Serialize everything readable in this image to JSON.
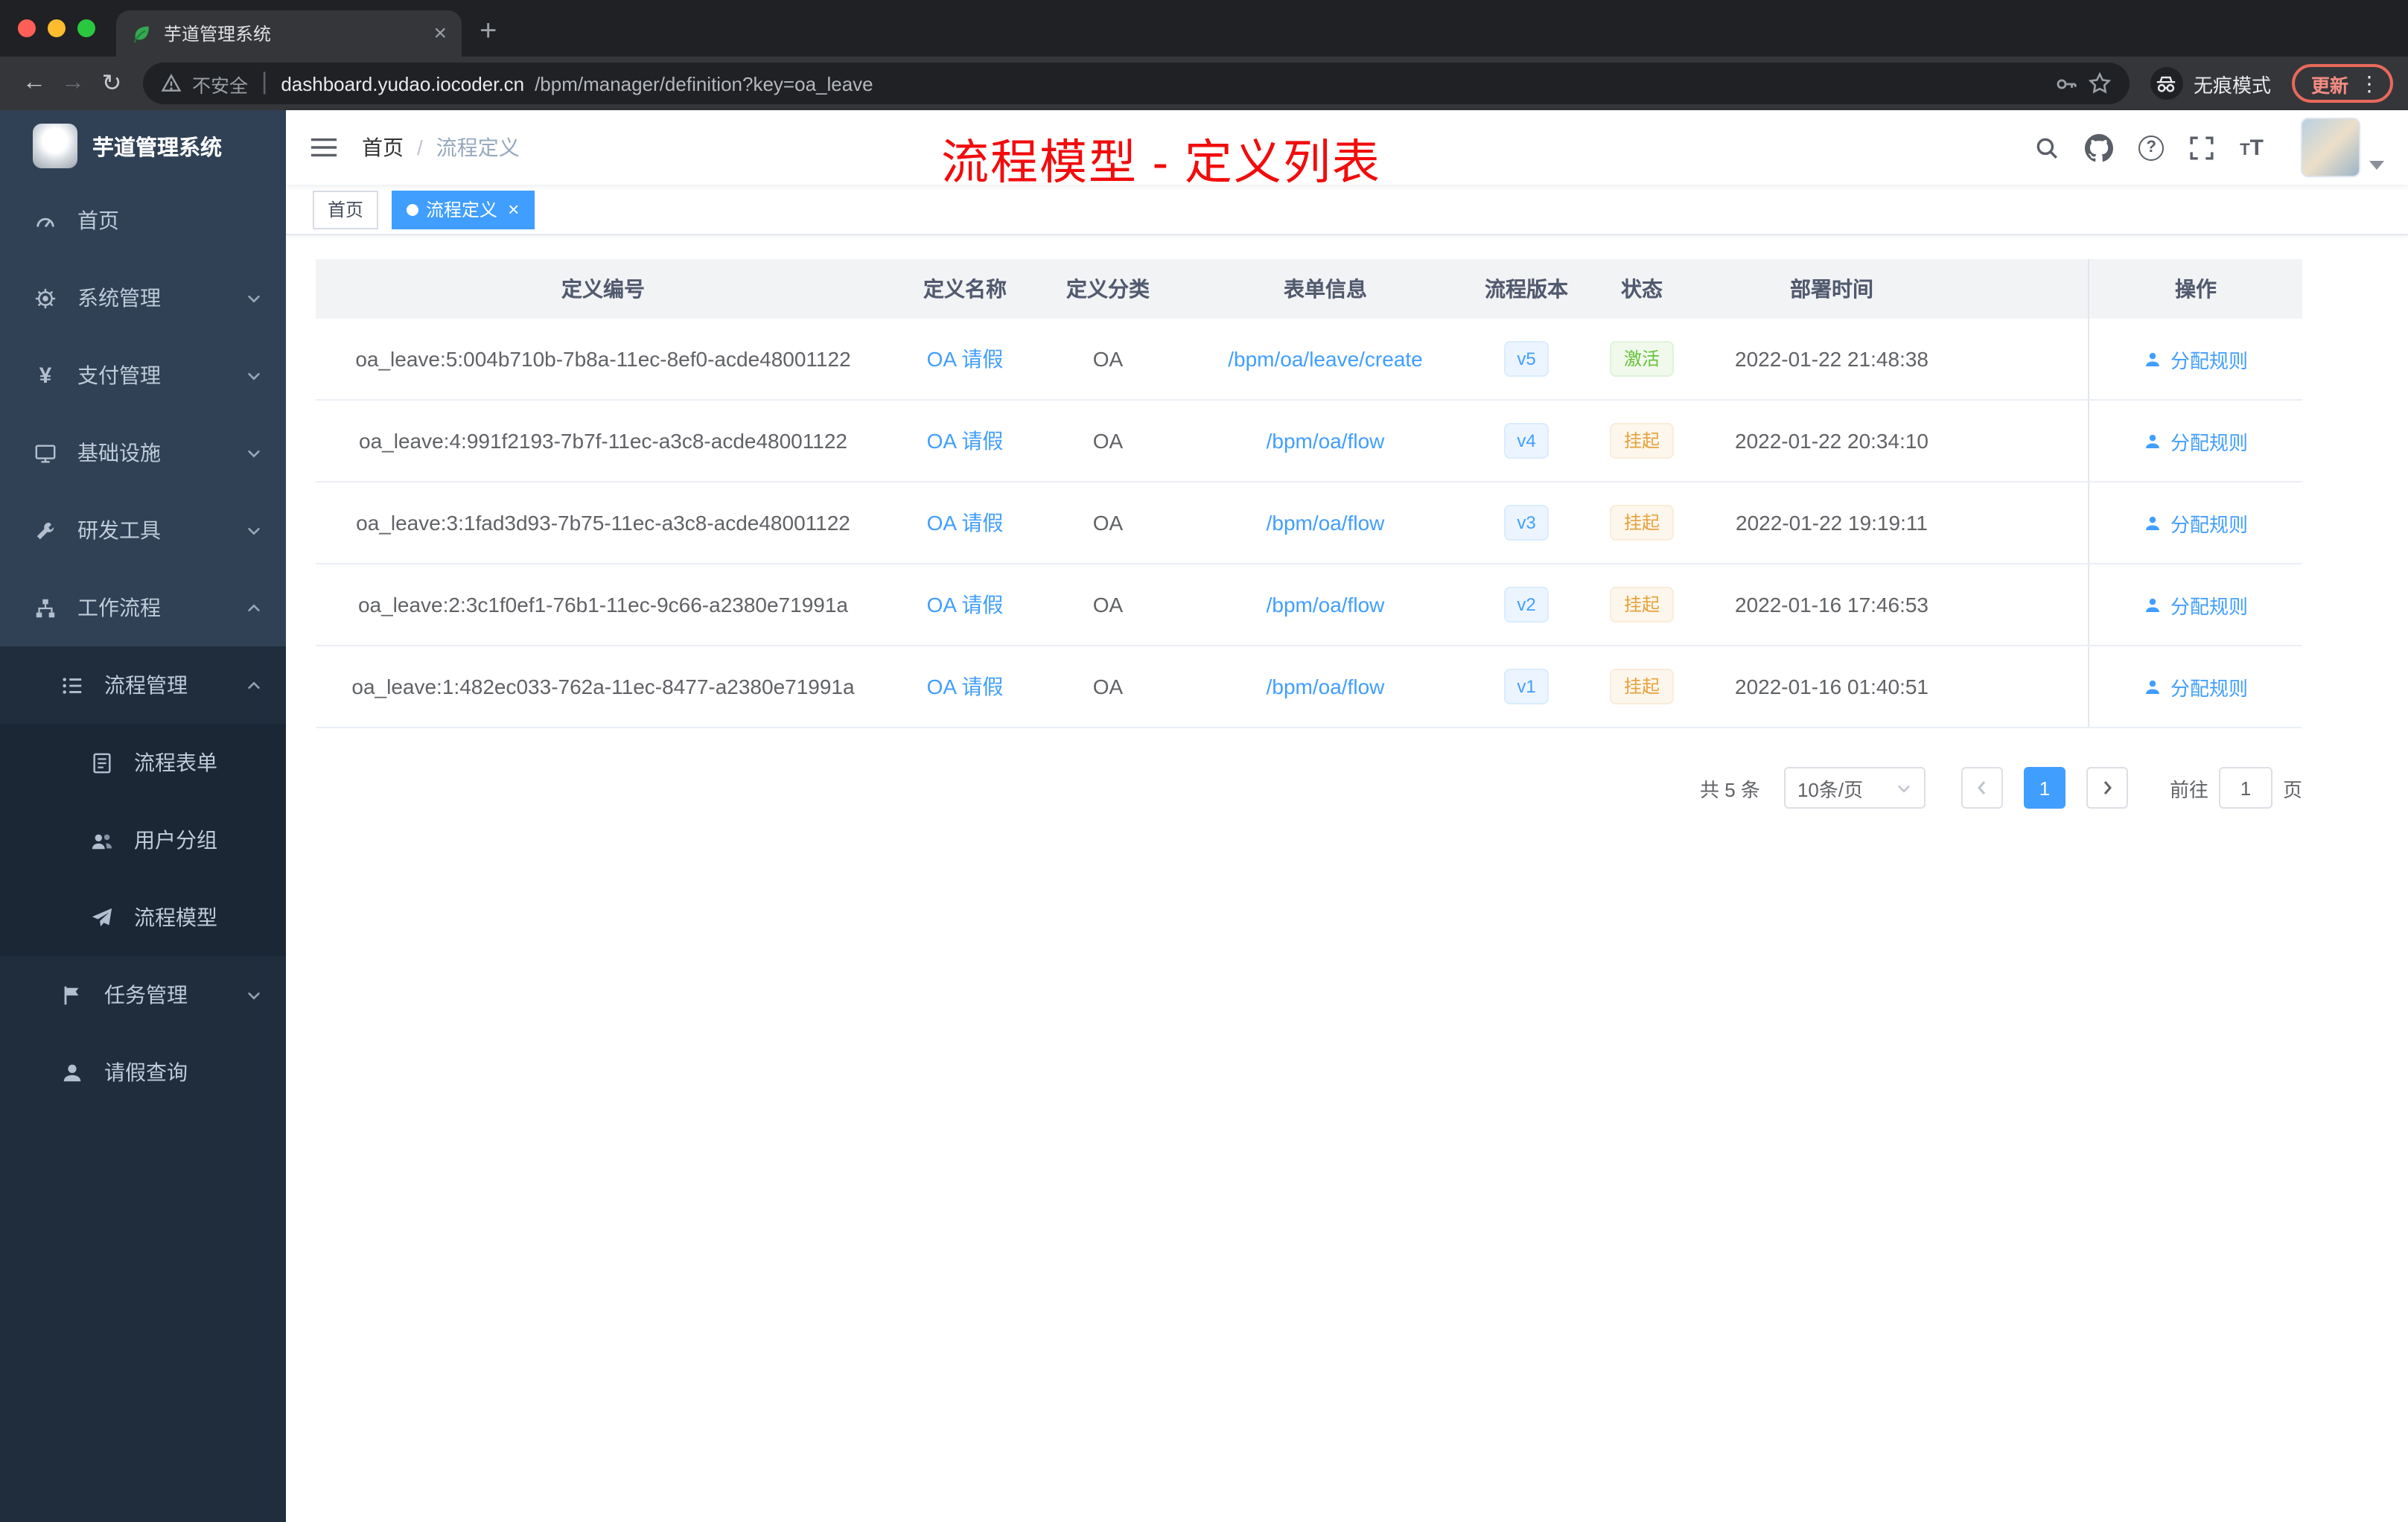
{
  "browser": {
    "tab_title": "芋道管理系统",
    "new_tab": "+",
    "security_label": "不安全",
    "url_host": "dashboard.yudao.iocoder.cn",
    "url_path": "/bpm/manager/definition?key=oa_leave",
    "incognito_label": "无痕模式",
    "update_label": "更新"
  },
  "sidebar": {
    "title": "芋道管理系统",
    "items": [
      {
        "label": "首页"
      },
      {
        "label": "系统管理"
      },
      {
        "label": "支付管理"
      },
      {
        "label": "基础设施"
      },
      {
        "label": "研发工具"
      },
      {
        "label": "工作流程"
      },
      {
        "label": "流程管理"
      },
      {
        "label": "流程表单"
      },
      {
        "label": "用户分组"
      },
      {
        "label": "流程模型"
      },
      {
        "label": "任务管理"
      },
      {
        "label": "请假查询"
      }
    ]
  },
  "navbar": {
    "breadcrumb_home": "首页",
    "breadcrumb_current": "流程定义"
  },
  "annotation": {
    "text": "流程模型 - 定义列表"
  },
  "tags": {
    "home": "首页",
    "active": "流程定义"
  },
  "table": {
    "columns": [
      "定义编号",
      "定义名称",
      "定义分类",
      "表单信息",
      "流程版本",
      "状态",
      "部署时间",
      "操作"
    ],
    "rows": [
      {
        "id": "oa_leave:5:004b710b-7b8a-11ec-8ef0-acde48001122",
        "name": "OA 请假",
        "category": "OA",
        "form": "/bpm/oa/leave/create",
        "version": "v5",
        "status": "激活",
        "status_type": "success",
        "time": "2022-01-22 21:48:38",
        "action": "分配规则"
      },
      {
        "id": "oa_leave:4:991f2193-7b7f-11ec-a3c8-acde48001122",
        "name": "OA 请假",
        "category": "OA",
        "form": "/bpm/oa/flow",
        "version": "v4",
        "status": "挂起",
        "status_type": "warning",
        "time": "2022-01-22 20:34:10",
        "action": "分配规则"
      },
      {
        "id": "oa_leave:3:1fad3d93-7b75-11ec-a3c8-acde48001122",
        "name": "OA 请假",
        "category": "OA",
        "form": "/bpm/oa/flow",
        "version": "v3",
        "status": "挂起",
        "status_type": "warning",
        "time": "2022-01-22 19:19:11",
        "action": "分配规则"
      },
      {
        "id": "oa_leave:2:3c1f0ef1-76b1-11ec-9c66-a2380e71991a",
        "name": "OA 请假",
        "category": "OA",
        "form": "/bpm/oa/flow",
        "version": "v2",
        "status": "挂起",
        "status_type": "warning",
        "time": "2022-01-16 17:46:53",
        "action": "分配规则"
      },
      {
        "id": "oa_leave:1:482ec033-762a-11ec-8477-a2380e71991a",
        "name": "OA 请假",
        "category": "OA",
        "form": "/bpm/oa/flow",
        "version": "v1",
        "status": "挂起",
        "status_type": "warning",
        "time": "2022-01-16 01:40:51",
        "action": "分配规则"
      }
    ]
  },
  "pagination": {
    "total": "共 5 条",
    "page_size": "10条/页",
    "current_page": "1",
    "goto_label": "前往",
    "goto_value": "1",
    "unit_label": "页"
  },
  "colors": {
    "accent": "#409eff",
    "success": "#67c23a",
    "warning": "#e6a23c",
    "annotation_red": "#f20c0c",
    "sidebar_bg": "#304156",
    "submenu_bg": "#1f2d3d"
  }
}
